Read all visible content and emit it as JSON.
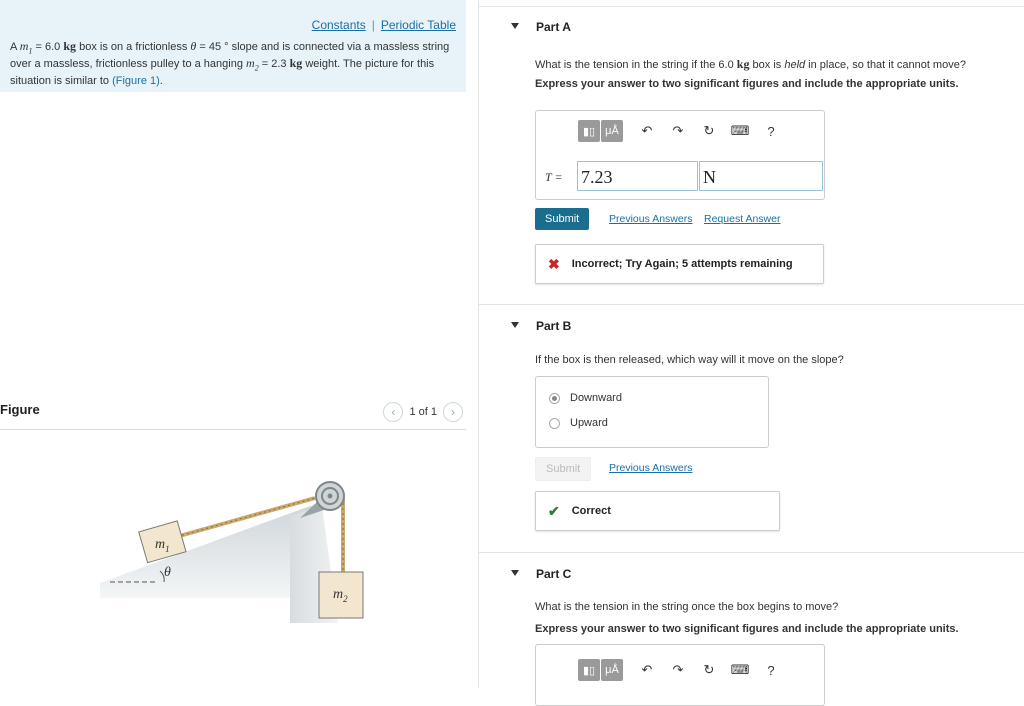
{
  "links": {
    "constants": "Constants",
    "separator": "|",
    "periodic_table": "Periodic Table"
  },
  "problem": {
    "p1": "A ",
    "m1": "m",
    "m1_sub": "1",
    "p2": " = 6.0 ",
    "kg1": "kg",
    "p3": " box is on a frictionless ",
    "theta": "θ",
    "p4": " = 45 ° slope and is connected via a massless string over a massless, frictionless pulley to a hanging ",
    "m2": "m",
    "m2_sub": "2",
    "p5": " = 2.3 ",
    "kg2": "kg",
    "p6": " weight. The picture for this situation is similar to ",
    "figure_link": "(Figure 1)",
    "p7": "."
  },
  "figure": {
    "title": "Figure",
    "pager": {
      "prev": "‹",
      "count": "1 of 1",
      "next": "›"
    },
    "labels": {
      "m1": "m",
      "m1_sub": "1",
      "theta": "θ",
      "m2": "m",
      "m2_sub": "2"
    }
  },
  "toolbar": {
    "templates_icon": "templates-icon",
    "mu_label": "μÅ",
    "undo": "↶",
    "redo": "↷",
    "reset": "↻",
    "keyboard": "⌨",
    "help": "?"
  },
  "partA": {
    "header": "Part A",
    "question_pre": "What is the tension in the string if the 6.0 ",
    "question_kg": "kg",
    "question_mid": " box is ",
    "question_em": "held",
    "question_post": " in place, so that it cannot move?",
    "instruction": "Express your answer to two significant figures and include the appropriate units.",
    "eq_label": "T =",
    "value": "7.23",
    "units": "N",
    "submit": "Submit",
    "previous_answers": "Previous Answers",
    "request_answer": "Request Answer",
    "feedback": "Incorrect; Try Again; 5 attempts remaining",
    "feedback_mark": "✖",
    "feedback_color": "#c62828"
  },
  "partB": {
    "header": "Part B",
    "question": "If the box is then released, which way will it move on the slope?",
    "options": [
      "Downward",
      "Upward"
    ],
    "selected": "Downward",
    "submit": "Submit",
    "previous_answers": "Previous Answers",
    "feedback": "Correct",
    "feedback_mark": "✔",
    "feedback_color": "#2e7d32"
  },
  "partC": {
    "header": "Part C",
    "question": "What is the tension in the string once the box begins to move?",
    "instruction": "Express your answer to two significant figures and include the appropriate units."
  },
  "colors": {
    "accent": "#1a6d8f",
    "link": "#1a6fa8",
    "intro_bg": "#e7f3f8"
  }
}
